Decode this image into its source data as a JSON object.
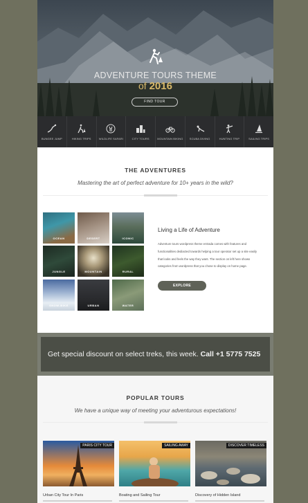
{
  "hero": {
    "title": "ADVENTURE TOURS THEME",
    "year_prefix": "of",
    "year": "2016",
    "find_button": "FIND TOUR",
    "logo_icon": "hiker-icon"
  },
  "activities": [
    {
      "label": "BUNGEE JUMP",
      "icon": "bungee-icon"
    },
    {
      "label": "HIKING TRIPS",
      "icon": "hiker-icon"
    },
    {
      "label": "WILDLIFE SAFARI",
      "icon": "deer-icon"
    },
    {
      "label": "CITY TOURS",
      "icon": "city-icon"
    },
    {
      "label": "MOUNTAIN BIKING",
      "icon": "bike-icon"
    },
    {
      "label": "SCUBA DIVING",
      "icon": "diver-icon"
    },
    {
      "label": "HUNTING TRIP",
      "icon": "hunter-icon"
    },
    {
      "label": "SAILING TRIPS",
      "icon": "sail-icon"
    }
  ],
  "adventures": {
    "title": "THE ADVENTURES",
    "subtitle": "Mastering the art of perfect adventure for 10+ years in the wild?",
    "tiles": [
      {
        "label": "OCEAN"
      },
      {
        "label": "DESERT"
      },
      {
        "label": "ICONIC"
      },
      {
        "label": "JUNGLE"
      },
      {
        "label": "MOUNTAIN"
      },
      {
        "label": "RURAL"
      },
      {
        "label": "SNOW-BIKE"
      },
      {
        "label": "URBAN"
      },
      {
        "label": "WATER"
      }
    ],
    "life_title": "Living a Life of Adventure",
    "life_text": "Adventure tours wordpress theme entrada comes with features and functionalities dediacted towards helping a tour operator set up a site easily that looks and feels the way they want. The section on left here shows categories from wordpress that you chose to display on home page.",
    "explore_button": "EXPLORE"
  },
  "discount": {
    "text": "Get special discount on select treks, this week.",
    "phone": "Call +1 5775 7525"
  },
  "popular": {
    "title": "POPULAR TOURS",
    "subtitle": "We have a unique way of meeting your adventurous expectations!",
    "tours": [
      {
        "tag": "PARIS CITY TOUR",
        "name": "Urban City Tour In Paris"
      },
      {
        "tag": "SAILING AWAY",
        "name": "Boating and Sailing Tour"
      },
      {
        "tag": "DISCOVER TIMELESS",
        "name": "Discovery of Hidden Island"
      }
    ]
  },
  "colors": {
    "accent_gold": "#d9b96a",
    "dark_bar": "#2b2c2e",
    "explore_button": "#5f6258",
    "discount_box": "#4b4e46"
  }
}
